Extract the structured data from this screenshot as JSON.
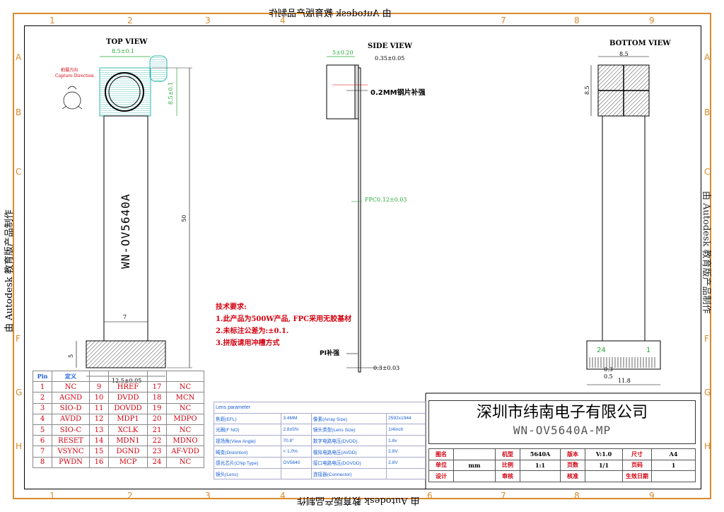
{
  "watermark": {
    "text": "由 Autodesk 教育版产品制作"
  },
  "zones": {
    "numbers": [
      "1",
      "2",
      "3",
      "4",
      "5",
      "6",
      "7",
      "8",
      "9"
    ],
    "letters": [
      "A",
      "B",
      "C",
      "D",
      "E",
      "F",
      "G",
      "H"
    ]
  },
  "top_view": {
    "title": "TOP VIEW",
    "width_dim": "8.5±0.1",
    "height_dim": "8.5±0.1",
    "capture_cn": "拍摄方向",
    "capture_en": "Capture Direction",
    "model_text": "WN-OV5640A",
    "length_dim": "50",
    "fpc_width_dim": "7",
    "connector_height_dim": "5",
    "connector_width_dim": "12.5±0.05"
  },
  "side_view": {
    "title": "SIDE VIEW",
    "height_dim": "5±0.20",
    "thickness_dim": "0.35±0.05",
    "stiffener_label": "0.2MM钢片补强",
    "fpc_label": "FPC0.12±0.03",
    "pi_label": "PI补强",
    "pi_dim": "0.3±0.03"
  },
  "bottom_view": {
    "title": "BOTTOM VIEW",
    "width_dim": "8.5",
    "height_dim": "8.5",
    "pin_left": "24",
    "pin_right": "1",
    "pitch_dim": "0.3",
    "pad_dim": "0.5",
    "connector_dim": "11.8"
  },
  "requirements": {
    "title": "技术要求:",
    "items": [
      "1.此产品为500W产品, FPC采用无胶基材",
      "2.未标注公差为:±0.1.",
      "3.拼版请用冲槽方式"
    ]
  },
  "pin_table": {
    "header_pin": "Pin",
    "header_def": "定义",
    "rows": [
      [
        "1",
        "NC",
        "9",
        "HREF",
        "17",
        "NC"
      ],
      [
        "2",
        "AGND",
        "10",
        "DVDD",
        "18",
        "MCN"
      ],
      [
        "3",
        "SIO-D",
        "11",
        "DOVDD",
        "19",
        "NC"
      ],
      [
        "4",
        "AVDD",
        "12",
        "MDP1",
        "20",
        "MDPO"
      ],
      [
        "5",
        "SIO-C",
        "13",
        "XCLK",
        "21",
        "NC"
      ],
      [
        "6",
        "RESET",
        "14",
        "MDN1",
        "22",
        "MDNO"
      ],
      [
        "7",
        "VSYNC",
        "15",
        "DGND",
        "23",
        "AF-VDD"
      ],
      [
        "8",
        "PWDN",
        "16",
        "MCP",
        "24",
        "NC"
      ]
    ]
  },
  "lens_params": {
    "title": "Lens parameter",
    "rows": [
      [
        "焦距(EFL)",
        "3.4MM",
        "像素(Array Size)",
        "2592x1944"
      ],
      [
        "光圈(F NO)",
        "2.8±5%",
        "镜头类型(Lens Size)",
        "1/4inch"
      ],
      [
        "视场角(View Angle)",
        "70.8°",
        "数字电路电压(DVDD)",
        "1.8v"
      ],
      [
        "畸变(Distortion)",
        "< 1.0%",
        "模拟电路电压(AVDD)",
        "2.8V"
      ],
      [
        "感光芯片(Chip Type)",
        "OV5640",
        "接口电路电压(DOVDD)",
        "2.8V"
      ],
      [
        "镜头(Lens)",
        "",
        "连接器(Connector)",
        ""
      ]
    ]
  },
  "title_block": {
    "company": "深圳市纬南电子有限公司",
    "drawing_no": "WN-OV5640A-MP",
    "rows": [
      [
        "图名",
        "",
        "机型",
        "5640A",
        "版本",
        "V:1.0",
        "尺寸",
        "A4"
      ],
      [
        "单位",
        "mm",
        "比例",
        "1:1",
        "页数",
        "1/1",
        "页码",
        "1"
      ],
      [
        "设计",
        "",
        "审核",
        "",
        "核准",
        "",
        "生效日期",
        ""
      ]
    ]
  }
}
